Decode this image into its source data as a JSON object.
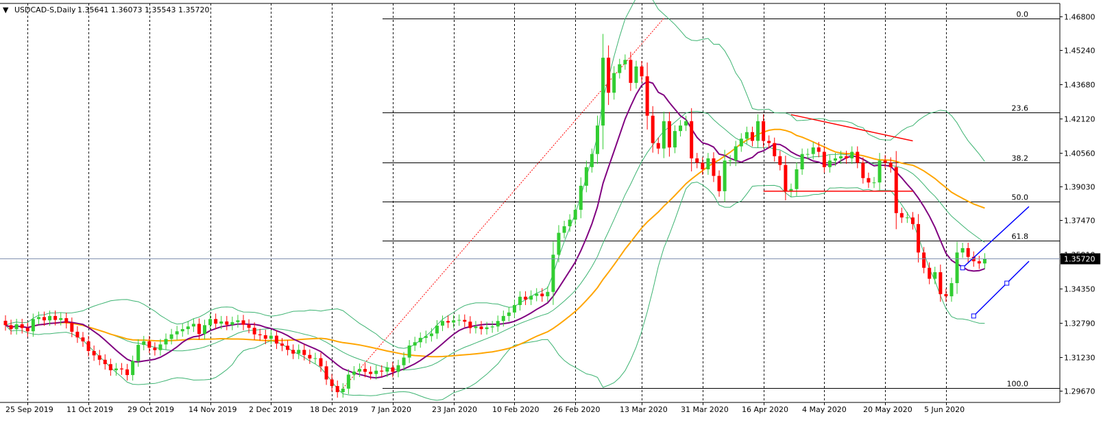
{
  "header": {
    "symbol_label": "USDCAD-S,Daily",
    "ohlc_text": "1.35641 1.36073 1.35543 1.35720"
  },
  "colors": {
    "background": "#ffffff",
    "bull_candle": "#32cd32",
    "bear_candle": "#ff0000",
    "sma_fast": "#800080",
    "sma_slow": "#ffa500",
    "bollinger": "#3cb371",
    "fib_lines": "#000000",
    "channel": "#0000ff",
    "triangle": "#ff0000",
    "price_tag_bg": "#000000",
    "price_tag_fg": "#ffffff"
  },
  "chart_data": {
    "type": "candlestick",
    "title": "USDCAD-S,Daily",
    "last_price": "1.35720",
    "ylim": [
      1.2915,
      1.4738
    ],
    "y_ticks": [
      "1.46800",
      "1.45240",
      "1.43680",
      "1.42120",
      "1.40560",
      "1.39030",
      "1.37470",
      "1.35910",
      "1.34350",
      "1.32790",
      "1.31230",
      "1.29670"
    ],
    "x_ticks": [
      "25 Sep 2019",
      "11 Oct 2019",
      "29 Oct 2019",
      "14 Nov 2019",
      "2 Dec 2019",
      "18 Dec 2019",
      "7 Jan 2020",
      "23 Jan 2020",
      "10 Feb 2020",
      "26 Feb 2020",
      "13 Mar 2020",
      "31 Mar 2020",
      "16 Apr 2020",
      "4 May 2020",
      "20 May 2020",
      "5 Jun 2020"
    ],
    "fibonacci": [
      {
        "label": "0.0",
        "price": 1.467
      },
      {
        "label": "23.6",
        "price": 1.424
      },
      {
        "label": "38.2",
        "price": 1.401
      },
      {
        "label": "50.0",
        "price": 1.3833
      },
      {
        "label": "61.8",
        "price": 1.3655
      },
      {
        "label": "100.0",
        "price": 1.298
      }
    ],
    "close_series": [
      1.3268,
      1.325,
      1.3272,
      1.3255,
      1.324,
      1.3296,
      1.3305,
      1.329,
      1.331,
      1.3292,
      1.33,
      1.3278,
      1.3238,
      1.3212,
      1.3194,
      1.315,
      1.313,
      1.311,
      1.309,
      1.3062,
      1.307,
      1.3066,
      1.304,
      1.3104,
      1.3178,
      1.3194,
      1.3165,
      1.3154,
      1.318,
      1.3205,
      1.3226,
      1.324,
      1.325,
      1.3262,
      1.3274,
      1.3228,
      1.3268,
      1.3296,
      1.3275,
      1.3285,
      1.327,
      1.3282,
      1.329,
      1.327,
      1.3256,
      1.3226,
      1.3222,
      1.3206,
      1.322,
      1.3184,
      1.3174,
      1.3155,
      1.3138,
      1.3155,
      1.3132,
      1.3116,
      1.3117,
      1.308,
      1.302,
      1.299,
      1.2962,
      1.2978,
      1.3042,
      1.3056,
      1.3068,
      1.3055,
      1.3045,
      1.306,
      1.3056,
      1.3075,
      1.3055,
      1.3085,
      1.312,
      1.3175,
      1.319,
      1.321,
      1.3218,
      1.323,
      1.3266,
      1.3287,
      1.328,
      1.329,
      1.3292,
      1.3284,
      1.3255,
      1.3262,
      1.325,
      1.3258,
      1.3262,
      1.3287,
      1.331,
      1.3326,
      1.336,
      1.3398,
      1.3385,
      1.3402,
      1.3412,
      1.34,
      1.342,
      1.359,
      1.369,
      1.372,
      1.375,
      1.3795,
      1.3905,
      1.399,
      1.405,
      1.418,
      1.449,
      1.433,
      1.442,
      1.446,
      1.448,
      1.4375,
      1.445,
      1.4405,
      1.4225,
      1.41,
      1.4075,
      1.42,
      1.408,
      1.4155,
      1.418,
      1.42,
      1.403,
      1.401,
      1.398,
      1.403,
      1.395,
      1.388,
      1.402,
      1.402,
      1.4085,
      1.412,
      1.415,
      1.411,
      1.42,
      1.411,
      1.41,
      1.404,
      1.4,
      1.388,
      1.389,
      1.398,
      1.405,
      1.405,
      1.408,
      1.406,
      1.399,
      1.402,
      1.403,
      1.404,
      1.403,
      1.406,
      1.401,
      1.394,
      1.392,
      1.392,
      1.402,
      1.401,
      1.399,
      1.378,
      1.376,
      1.376,
      1.373,
      1.36,
      1.353,
      1.348,
      1.351,
      1.341,
      1.34,
      1.346,
      1.36,
      1.362,
      1.358,
      1.356,
      1.355,
      1.3572
    ]
  }
}
